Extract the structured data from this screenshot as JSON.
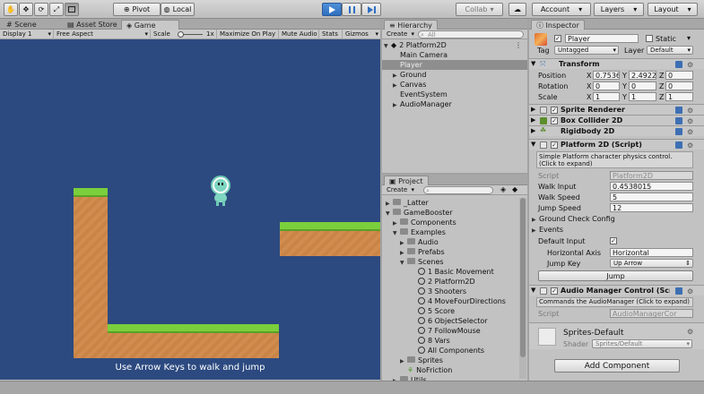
{
  "toolbar": {
    "pivot": "Pivot",
    "local": "Local",
    "collab": "Collab",
    "account": "Account",
    "layers": "Layers",
    "layout": "Layout"
  },
  "scene_tabs": {
    "scene": "Scene",
    "asset_store": "Asset Store",
    "game": "Game"
  },
  "game_bar": {
    "display": "Display 1",
    "aspect": "Free Aspect",
    "scale_label": "Scale",
    "scale_value": "1x",
    "maximize": "Maximize On Play",
    "mute": "Mute Audio",
    "stats": "Stats",
    "gizmos": "Gizmos"
  },
  "game": {
    "hint": "Use Arrow Keys to walk and jump"
  },
  "hierarchy": {
    "title": "Hierarchy",
    "create": "Create",
    "search_placeholder": "All",
    "scene": "2 Platform2D",
    "items": [
      "Main Camera",
      "Player",
      "Ground",
      "Canvas",
      "EventSystem",
      "AudioManager"
    ]
  },
  "project": {
    "title": "Project",
    "create": "Create",
    "items": [
      "_Latter",
      "GameBooster",
      "Components",
      "Examples",
      "Audio",
      "Prefabs",
      "Scenes",
      "1 Basic Movement",
      "2 Platform2D",
      "3 Shooters",
      "4 MoveFourDirections",
      "5 Score",
      "6 ObjectSelector",
      "7 FollowMouse",
      "8 Vars",
      "All Components",
      "Sprites",
      "NoFriction",
      "Utils"
    ]
  },
  "inspector": {
    "title": "Inspector",
    "object_name": "Player",
    "static": "Static",
    "tag_label": "Tag",
    "tag_value": "Untagged",
    "layer_label": "Layer",
    "layer_value": "Default",
    "transform": {
      "title": "Transform",
      "position": "Position",
      "rotation": "Rotation",
      "scale": "Scale",
      "x": "X",
      "y": "Y",
      "z": "Z",
      "pos": [
        "0.7536",
        "2.4922",
        "0"
      ],
      "rot": [
        "0",
        "0",
        "0"
      ],
      "scl": [
        "1",
        "1",
        "1"
      ]
    },
    "sprite_renderer": "Sprite Renderer",
    "box_collider": "Box Collider 2D",
    "rigidbody": "Rigidbody 2D",
    "platform": {
      "title": "Platform 2D (Script)",
      "desc": "Simple Platform character physics control. (Click to expand)",
      "script_label": "Script",
      "script_value": "Platform2D",
      "walk_input_label": "Walk Input",
      "walk_input": "0.4538015",
      "walk_speed_label": "Walk Speed",
      "walk_speed": "5",
      "jump_speed_label": "Jump Speed",
      "jump_speed": "12",
      "ground_check": "Ground Check Config",
      "events": "Events",
      "default_input": "Default Input",
      "horizontal_axis_label": "Horizontal Axis",
      "horizontal_axis": "Horizontal",
      "jump_key_label": "Jump Key",
      "jump_key": "Up Arrow",
      "jump_button": "Jump"
    },
    "audio": {
      "title": "Audio Manager Control (Scrip",
      "desc": "Commands the AudioManager  (Click to expand)",
      "script_label": "Script",
      "script_value": "AudioManagerCor"
    },
    "material": {
      "name": "Sprites-Default",
      "shader_label": "Shader",
      "shader_value": "Sprites/Default"
    },
    "add_component": "Add Component"
  }
}
